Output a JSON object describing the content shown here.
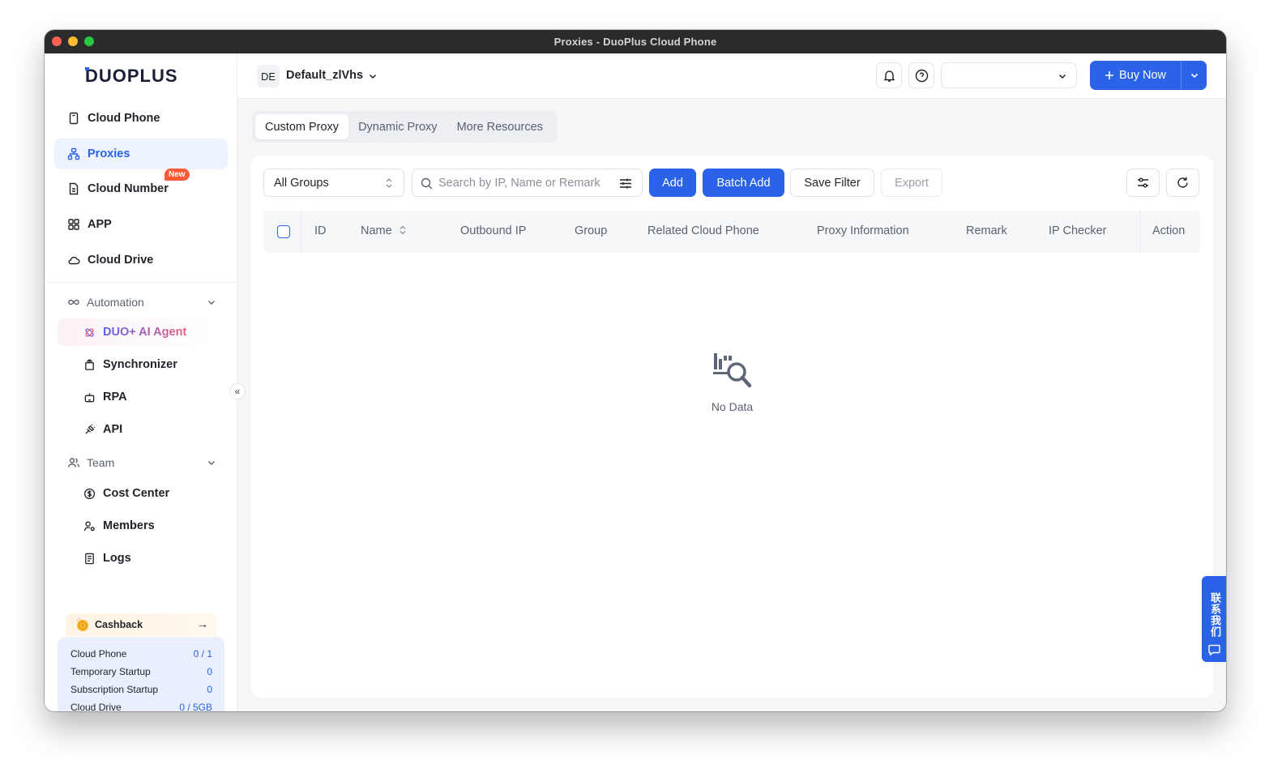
{
  "window": {
    "title": "Proxies - DuoPlus Cloud Phone"
  },
  "brand": {
    "logo_text": "DUOPLUS",
    "accent": "#2a62e8"
  },
  "sidebar": {
    "main_items": [
      {
        "label": "Cloud Phone",
        "icon": "phone-icon"
      },
      {
        "label": "Proxies",
        "icon": "proxies-icon",
        "active": true
      },
      {
        "label": "Cloud Number",
        "icon": "sim-icon",
        "badge": "New"
      },
      {
        "label": "APP",
        "icon": "apps-grid-icon"
      },
      {
        "label": "Cloud Drive",
        "icon": "cloud-icon"
      }
    ],
    "automation": {
      "label": "Automation",
      "items": [
        {
          "label": "DUO+ AI Agent",
          "icon": "ai-agent-icon"
        },
        {
          "label": "Synchronizer",
          "icon": "synchronizer-icon"
        },
        {
          "label": "RPA",
          "icon": "robot-icon"
        },
        {
          "label": "API",
          "icon": "api-plug-icon"
        }
      ]
    },
    "team": {
      "label": "Team",
      "items": [
        {
          "label": "Cost Center",
          "icon": "dollar-circle-icon"
        },
        {
          "label": "Members",
          "icon": "members-icon"
        },
        {
          "label": "Logs",
          "icon": "logs-icon"
        }
      ]
    },
    "cashback": {
      "label": "Cashback",
      "arrow": "→"
    },
    "quota": [
      {
        "label": "Cloud Phone",
        "value": "0 / 1"
      },
      {
        "label": "Temporary Startup",
        "value": "0"
      },
      {
        "label": "Subscription Startup",
        "value": "0"
      },
      {
        "label": "Cloud Drive",
        "value": "0 / 5GB"
      }
    ],
    "collapse_glyph": "«"
  },
  "header": {
    "workspace_initials": "DE",
    "workspace_name": "Default_zlVhs",
    "top_select_value": "",
    "buy_now_label": "Buy Now"
  },
  "tabs": [
    {
      "label": "Custom Proxy",
      "active": true
    },
    {
      "label": "Dynamic Proxy"
    },
    {
      "label": "More Resources"
    }
  ],
  "toolbar": {
    "group_select_value": "All Groups",
    "search_placeholder": "Search by IP, Name or Remark",
    "add_label": "Add",
    "batch_add_label": "Batch Add",
    "save_filter_label": "Save Filter",
    "export_label": "Export"
  },
  "table": {
    "columns": [
      "ID",
      "Name",
      "Outbound IP",
      "Group",
      "Related Cloud Phone",
      "Proxy Information",
      "Remark",
      "IP Checker",
      "Action"
    ],
    "rows": [],
    "empty_text": "No Data"
  },
  "contact": {
    "label": "联系我们"
  }
}
